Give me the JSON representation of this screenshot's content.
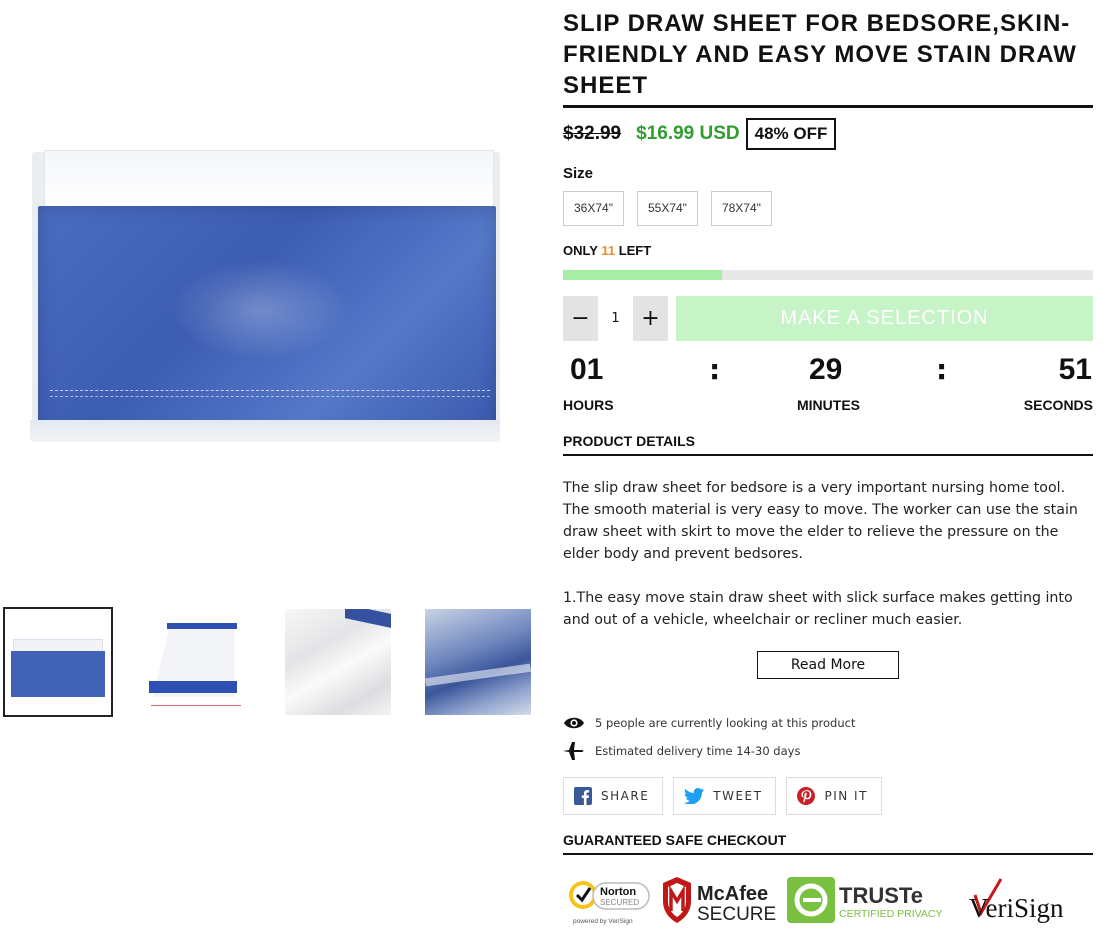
{
  "product": {
    "title": "SLIP DRAW SHEET FOR BEDSORE,SKIN-FRIENDLY AND EASY MOVE STAIN DRAW SHEET",
    "price_old": "$32.99",
    "price_new": "$16.99 USD",
    "discount": "48% OFF"
  },
  "size": {
    "label": "Size",
    "options": [
      "36X74\"",
      "55X74\"",
      "78X74\""
    ]
  },
  "stock": {
    "prefix": "ONLY",
    "count": "11",
    "suffix": "LEFT",
    "progress_percent": 30
  },
  "quantity": {
    "minus": "−",
    "value": "1",
    "plus": "+"
  },
  "add_button": "MAKE A SELECTION",
  "countdown": {
    "hours": "01",
    "minutes": "29",
    "seconds": "51",
    "hours_label": "HOURS",
    "minutes_label": "MINUTES",
    "seconds_label": "SECONDS",
    "separator": ":"
  },
  "details": {
    "heading": "PRODUCT DETAILS",
    "paragraph1": "The slip draw sheet for bedsore is a very important nursing home tool. The smooth material is very easy to move. The worker can use the stain draw sheet with skirt to move the elder to relieve the pressure on the elder body and prevent bedsores.",
    "paragraph2": "1.The easy move stain draw sheet with slick surface makes getting into and out of a vehicle, wheelchair or recliner much easier.",
    "read_more": "Read More"
  },
  "meta": {
    "viewers": "5 people are currently looking at this product",
    "delivery": "Estimated delivery time 14-30 days"
  },
  "share": {
    "facebook": "SHARE",
    "twitter": "TWEET",
    "pinterest": "PIN IT"
  },
  "checkout": {
    "heading": "GUARANTEED SAFE CHECKOUT",
    "norton_1": "Norton",
    "norton_2": "SECURED",
    "norton_3": "powered by VeriSign",
    "mcafee_1": "McAfee",
    "mcafee_2": "SECURE",
    "truste_1": "TRUSTe",
    "truste_2": "CERTIFIED PRIVACY",
    "verisign": "VeriSign"
  },
  "colors": {
    "sale_green": "#2f9e2f",
    "stock_orange": "#f08b2b",
    "progress_green": "#a6eda6",
    "button_green": "#c6f4c6",
    "sheet_blue": "#4262b8"
  }
}
